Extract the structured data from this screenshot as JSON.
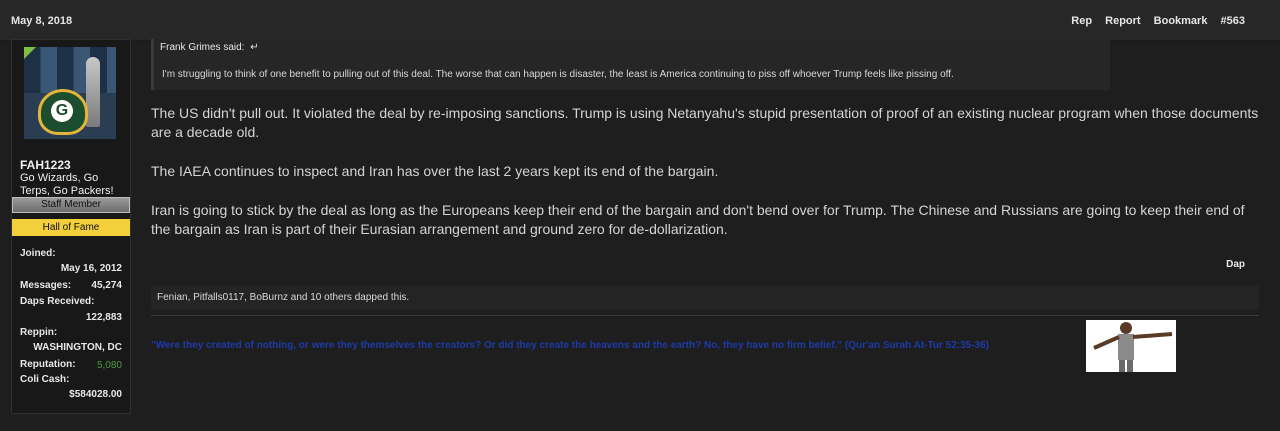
{
  "post": {
    "date": "May 8, 2018",
    "actions": [
      "Rep",
      "Report",
      "Bookmark",
      "#563"
    ]
  },
  "user": {
    "name": "FAH1223",
    "title": "Go Wizards, Go Terps, Go Packers!",
    "banner_staff": "Staff Member",
    "banner_hof": "Hall of Fame",
    "stats": {
      "joined_label": "Joined:",
      "joined_value": "May 16, 2012",
      "messages_label": "Messages:",
      "messages_value": "45,274",
      "daps_label": "Daps Received:",
      "daps_value": "122,883",
      "reppin_label": "Reppin:",
      "reppin_value": "WASHINGTON, DC",
      "reputation_label": "Reputation:",
      "reputation_value": "5,080",
      "colicash_label": "Coli Cash:",
      "colicash_value": "$584028.00"
    }
  },
  "quote": {
    "author": "Frank Grimes said:",
    "arrow": "↵",
    "text": "I'm struggling to think of one benefit to pulling out of this deal. The worse that can happen is disaster, the least is America continuing to piss off whoever Trump feels like pissing off."
  },
  "message": {
    "paragraphs": [
      "The US didn't pull out. It violated the deal by re-imposing sanctions. Trump is using Netanyahu's stupid presentation of proof of an existing nuclear program when those documents are a decade old.",
      "The IAEA continues to inspect and Iran has over the last 2 years kept its end of the bargain.",
      "Iran is going to stick by the deal as long as the Europeans keep their end of the bargain and don't bend over for Trump. The Chinese and Russians are going to keep their end of the bargain as Iran is part of their Eurasian arrangement and ground zero for de-dollarization."
    ]
  },
  "dap_label": "Dap",
  "likes": {
    "text": "Fenian, Pitfalls0117, BoBurnz and 10 others dapped this."
  },
  "signature": {
    "text": "\"Were they created of nothing, or were they themselves the creators? Or did they create the heavens and the earth? No, they have no firm belief.\" (Qur'an Surah At-Tur 52:35-36)"
  },
  "colors": {
    "signature": "#1c3aa8",
    "hall_of_fame": "#f2cf3b",
    "reputation": "#4e9a3d"
  },
  "icons": [
    "quote-jump-arrow-icon",
    "avatar",
    "signature-figure-image"
  ]
}
